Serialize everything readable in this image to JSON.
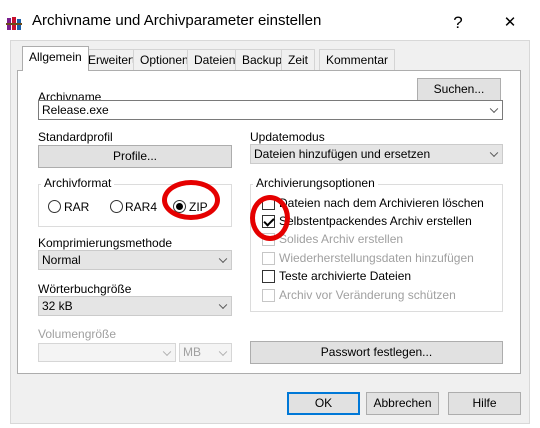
{
  "window": {
    "title": "Archivname und Archivparameter einstellen",
    "help_glyph": "?",
    "close_glyph": "✕",
    "icon": "winrar-books-icon"
  },
  "tabs": [
    {
      "label": "Allgemein",
      "active": true
    },
    {
      "label": "Erweitert"
    },
    {
      "label": "Optionen"
    },
    {
      "label": "Dateien"
    },
    {
      "label": "Backup"
    },
    {
      "label": "Zeit"
    },
    {
      "label": "Kommentar"
    }
  ],
  "archive_name": {
    "label": "Archivname",
    "value": "Release.exe",
    "browse_label": "Suchen..."
  },
  "profile": {
    "label": "Standardprofil",
    "button_label": "Profile..."
  },
  "update_mode": {
    "label": "Updatemodus",
    "value": "Dateien hinzufügen und ersetzen"
  },
  "archive_format": {
    "label": "Archivformat",
    "options": [
      "RAR",
      "RAR4",
      "ZIP"
    ],
    "selected": "ZIP"
  },
  "compression": {
    "label": "Komprimierungsmethode",
    "value": "Normal"
  },
  "dictionary": {
    "label": "Wörterbuchgröße",
    "value": "32 kB"
  },
  "volume": {
    "label": "Volumengröße",
    "value": "",
    "unit": "MB"
  },
  "archive_options": {
    "label": "Archivierungsoptionen",
    "items": [
      {
        "label": "Dateien nach dem Archivieren löschen",
        "checked": false,
        "enabled": true
      },
      {
        "label": "Selbstentpackendes Archiv erstellen",
        "checked": true,
        "enabled": true
      },
      {
        "label": "Solides Archiv erstellen",
        "checked": false,
        "enabled": false
      },
      {
        "label": "Wiederherstellungsdaten hinzufügen",
        "checked": false,
        "enabled": false
      },
      {
        "label": "Teste archivierte Dateien",
        "checked": false,
        "enabled": true
      },
      {
        "label": "Archiv vor Veränderung schützen",
        "checked": false,
        "enabled": false
      }
    ]
  },
  "password_button_label": "Passwort festlegen...",
  "footer": {
    "ok_label": "OK",
    "cancel_label": "Abbrechen",
    "help_label": "Hilfe"
  },
  "annotation_color": "#e50000"
}
